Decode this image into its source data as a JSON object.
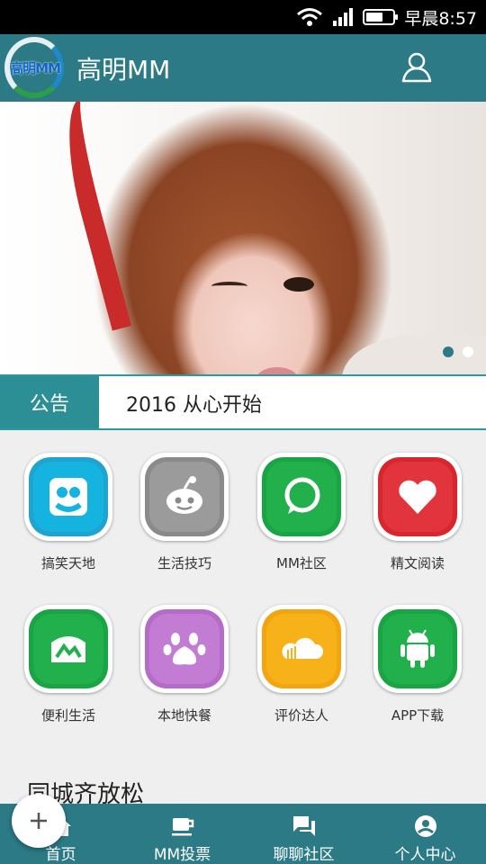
{
  "status_bar": {
    "time": "早晨8:57",
    "battery_level": 0.65
  },
  "app_bar": {
    "logo_text": "高明MM",
    "title": "高明MM"
  },
  "banner": {
    "slide_count": 2,
    "active_slide": 1
  },
  "notice": {
    "label": "公告",
    "text": "2016 从心开始"
  },
  "grid": {
    "items": [
      {
        "label": "搞笑天地",
        "icon": "funny-world-icon",
        "color": "#1fa3cf"
      },
      {
        "label": "生活技巧",
        "icon": "life-tips-icon",
        "color": "#8a8a8a"
      },
      {
        "label": "MM社区",
        "icon": "community-chat-icon",
        "color": "#1aa544"
      },
      {
        "label": "精文阅读",
        "icon": "heart-reading-icon",
        "color": "#d8262f"
      },
      {
        "label": "便利生活",
        "icon": "convenient-life-icon",
        "color": "#1aa544"
      },
      {
        "label": "本地快餐",
        "icon": "paw-food-icon",
        "color": "#b56bc7"
      },
      {
        "label": "评价达人",
        "icon": "cloud-review-icon",
        "color": "#f2a50f"
      },
      {
        "label": "APP下载",
        "icon": "android-icon",
        "color": "#1aa544"
      }
    ]
  },
  "section": {
    "title": "同城齐放松"
  },
  "bottom_nav": {
    "items": [
      {
        "label": "首页",
        "icon": "home-icon"
      },
      {
        "label": "MM投票",
        "icon": "coffee-cup-icon"
      },
      {
        "label": "聊聊社区",
        "icon": "chat-bubbles-icon"
      },
      {
        "label": "个人中心",
        "icon": "account-circle-icon"
      }
    ]
  },
  "colors": {
    "primary": "#2b7a86",
    "accent": "#2b9aa0"
  }
}
